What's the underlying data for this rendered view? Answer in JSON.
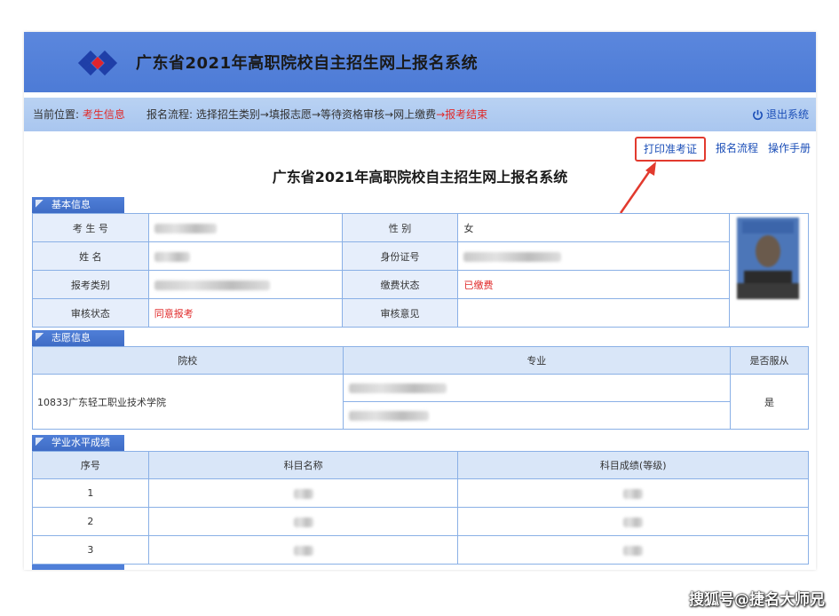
{
  "banner": {
    "title": "广东省2021年高职院校自主招生网上报名系统"
  },
  "breadcrumb": {
    "label": "当前位置:",
    "current": "考生信息",
    "flow_label": "报名流程:",
    "steps": [
      "选择招生类别",
      "→填报志愿",
      "→等待资格审核",
      "→网上缴费"
    ],
    "last_step": "→报考结束",
    "logout": "退出系统"
  },
  "links": {
    "print": "打印准考证",
    "process": "报名流程",
    "manual": "操作手册"
  },
  "page_title": "广东省2021年高职院校自主招生网上报名系统",
  "basic": {
    "tab": "基本信息",
    "rows": [
      {
        "l1": "考 生 号",
        "v1": "",
        "l2": "性    别",
        "v2": "女"
      },
      {
        "l1": "姓    名",
        "v1": "",
        "l2": "身份证号",
        "v2": ""
      },
      {
        "l1": "报考类别",
        "v1": "",
        "l2": "缴费状态",
        "v2": "已缴费"
      },
      {
        "l1": "审核状态",
        "v1": "同意报考",
        "l2": "审核意见",
        "v2": ""
      }
    ]
  },
  "volunteer": {
    "tab": "志愿信息",
    "headers": [
      "院校",
      "专业",
      "是否服从"
    ],
    "school": "10833广东轻工职业技术学院",
    "obey": "是"
  },
  "scores": {
    "tab": "学业水平成绩",
    "headers": [
      "序号",
      "科目名称",
      "科目成绩(等级)"
    ],
    "rows": [
      "1",
      "2",
      "3"
    ]
  },
  "watermark": "搜狐号@捷名大师兄",
  "colors": {
    "banner": "#4d7bd6",
    "crumb": "#a9c6ef",
    "link": "#1c4fb8",
    "alert": "#e02a2a"
  }
}
